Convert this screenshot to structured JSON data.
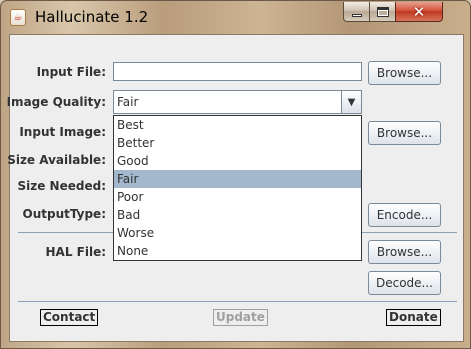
{
  "window": {
    "title": "Hallucinate 1.2",
    "icons": [
      "java-icon",
      "minimize-icon",
      "maximize-icon",
      "close-icon"
    ]
  },
  "labels": {
    "input_file": "Input File:",
    "image_quality": "Image Quality:",
    "input_image": "Input Image:",
    "size_available": "Size Available:",
    "size_needed": "Size Needed:",
    "output_type": "OutputType:",
    "hal_file": "HAL File:"
  },
  "fields": {
    "input_file_value": ""
  },
  "image_quality": {
    "selected": "Fair",
    "options": [
      "Best",
      "Better",
      "Good",
      "Fair",
      "Poor",
      "Bad",
      "Worse",
      "None"
    ]
  },
  "buttons": {
    "browse_input": "Browse...",
    "browse_image": "Browse...",
    "encode": "Encode...",
    "browse_hal": "Browse...",
    "decode": "Decode...",
    "contact": "Contact",
    "update": "Update",
    "donate": "Donate"
  },
  "colors": {
    "selection": "#a3b8cc",
    "close_button": "#c0391f"
  }
}
